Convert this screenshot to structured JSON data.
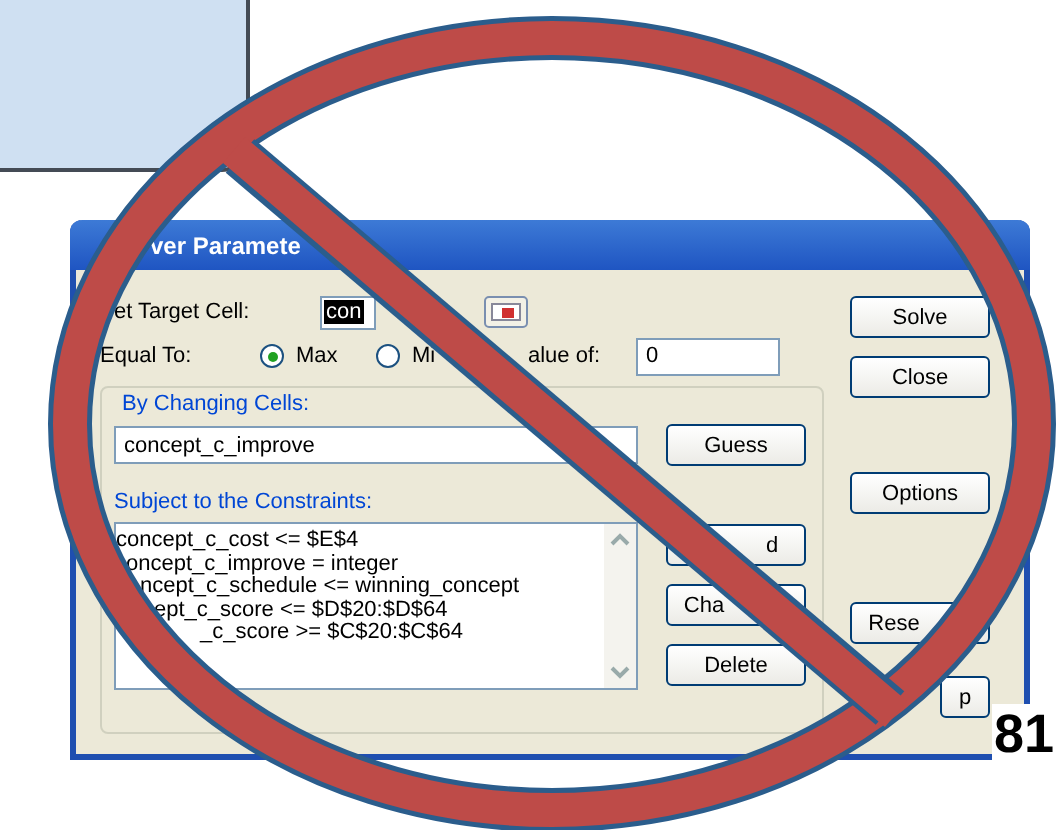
{
  "dialog": {
    "title": "ver Paramete",
    "target_cell": {
      "label": "et Target Cell:",
      "value": "con"
    },
    "equal_to": {
      "label": "Equal To:",
      "options": [
        {
          "label": "Max",
          "selected": true
        },
        {
          "label": "Mi",
          "selected": false
        },
        {
          "label": "alue of:"
        }
      ],
      "value": "0"
    },
    "changing_cells": {
      "label": "By Changing Cells:",
      "value": "concept_c_improve",
      "button": "Guess"
    },
    "constraints": {
      "label": "Subject to the Constraints:",
      "items": [
        "concept_c_cost <= $E$4",
        "oncept_c_improve = integer",
        "ncept_c_schedule <= winning_concept",
        "ept_c_score <= $D$20:$D$64",
        "_c_score >= $C$20:$C$64"
      ],
      "buttons": [
        "d",
        "Cha",
        "Delete"
      ]
    },
    "side_buttons": [
      "Solve",
      "Close",
      "Options",
      "Rese",
      "p"
    ]
  },
  "page_number": "81"
}
